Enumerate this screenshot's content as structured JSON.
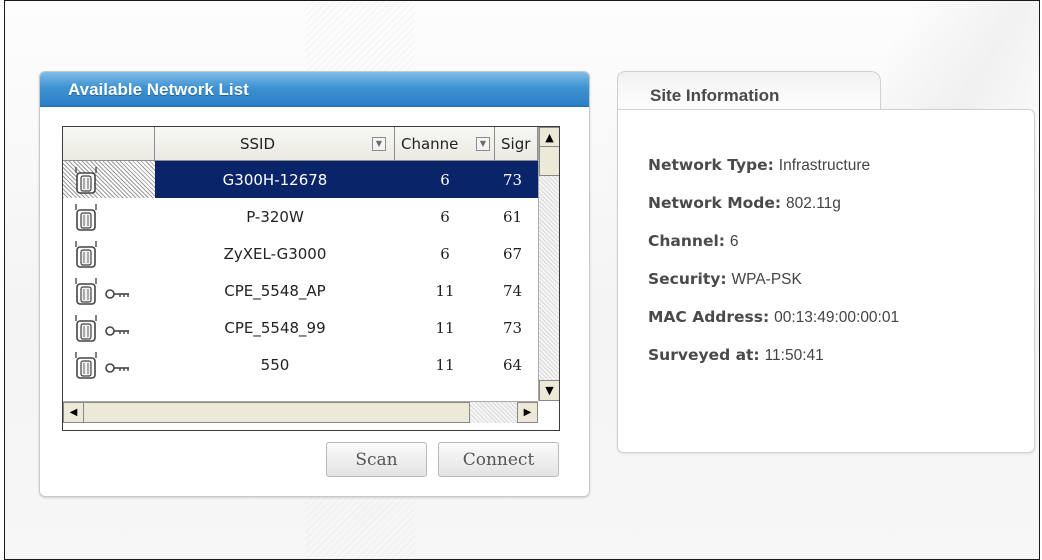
{
  "available_network_list": {
    "title": "Available Network List",
    "columns": [
      {
        "label": ""
      },
      {
        "label": "SSID"
      },
      {
        "label": "Channe"
      },
      {
        "label": "Sigr"
      }
    ],
    "rows": [
      {
        "ssid": "G300H-12678",
        "channel": "6",
        "signal": "73",
        "secured": false,
        "selected": true
      },
      {
        "ssid": "P-320W",
        "channel": "6",
        "signal": "61",
        "secured": false,
        "selected": false
      },
      {
        "ssid": "ZyXEL-G3000",
        "channel": "6",
        "signal": "67",
        "secured": false,
        "selected": false
      },
      {
        "ssid": "CPE_5548_AP",
        "channel": "11",
        "signal": "74",
        "secured": true,
        "selected": false
      },
      {
        "ssid": "CPE_5548_99",
        "channel": "11",
        "signal": "73",
        "secured": true,
        "selected": false
      },
      {
        "ssid": "550",
        "channel": "11",
        "signal": "64",
        "secured": true,
        "selected": false
      }
    ],
    "buttons": {
      "scan": "Scan",
      "connect": "Connect"
    },
    "icons": {
      "access_point": "access-point-icon",
      "key": "key-icon"
    }
  },
  "site_information": {
    "tab_title": "Site Information",
    "fields": [
      {
        "label": "Network Type:",
        "value": "Infrastructure"
      },
      {
        "label": "Network Mode:",
        "value": "802.11g"
      },
      {
        "label": "Channel:",
        "value": "6"
      },
      {
        "label": "Security:",
        "value": "WPA-PSK"
      },
      {
        "label": "MAC Address:",
        "value": "00:13:49:00:00:01"
      },
      {
        "label": "Surveyed at:",
        "value": "11:50:41"
      }
    ]
  },
  "colors": {
    "header_blue": "#2a7ec4",
    "selection": "#0a246a"
  }
}
